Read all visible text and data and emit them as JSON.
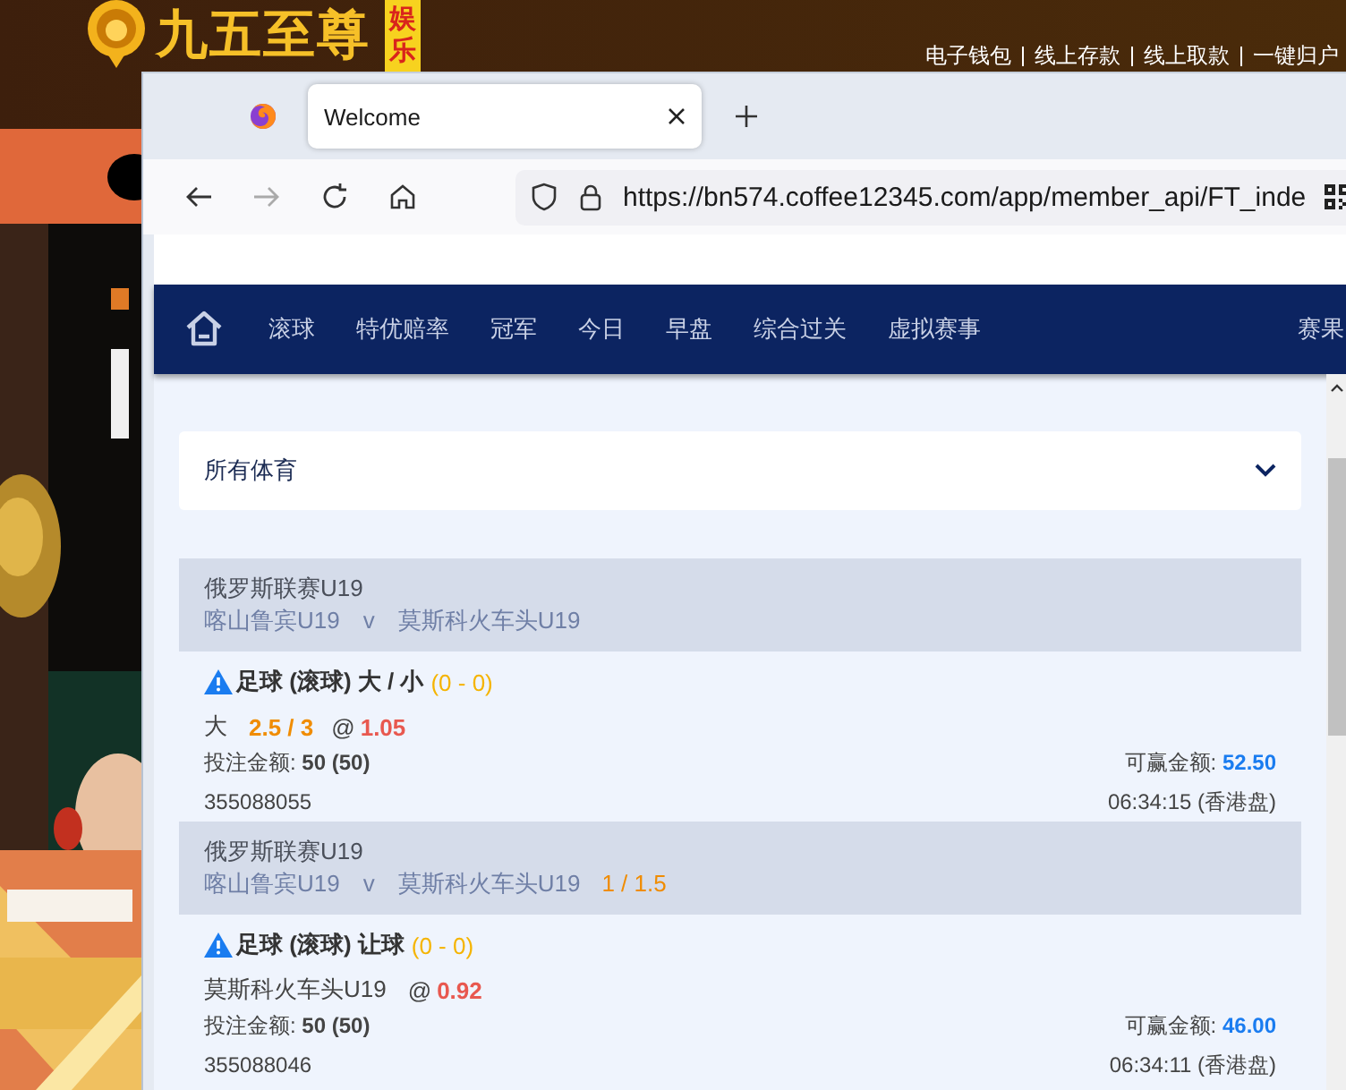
{
  "background_site": {
    "logo_text": "九五至尊",
    "logo_badge": "娱乐",
    "links": [
      "电子钱包",
      "线上存款",
      "线上取款",
      "一键归户"
    ]
  },
  "browser": {
    "tab": {
      "title": "Welcome"
    },
    "address": "https://bn574.coffee12345.com/app/member_api/FT_inde"
  },
  "nav": {
    "items": [
      {
        "label": "滚球"
      },
      {
        "label": "特优赔率"
      },
      {
        "label": "冠军"
      },
      {
        "label": "今日"
      },
      {
        "label": "早盘"
      },
      {
        "label": "综合过关"
      },
      {
        "label": "虚拟赛事"
      },
      {
        "label": "赛果",
        "kind": "end"
      }
    ]
  },
  "sport_select": {
    "value": "所有体育"
  },
  "bets": [
    {
      "league": "俄罗斯联赛U19",
      "home": "喀山鲁宾U19",
      "vs": "v",
      "away": "莫斯科火车头U19",
      "market": "足球 (滚球) 大 / 小",
      "score": "(0 - 0)",
      "selection": "大",
      "line": "2.5 / 3",
      "at": "@",
      "odds": "1.05",
      "stake_label": "投注金额:",
      "stake": "50 (50)",
      "win_label": "可赢金额:",
      "win": "52.50",
      "ticket": "355088055",
      "time": "06:34:15 (香港盘)"
    },
    {
      "league": "俄罗斯联赛U19",
      "home": "喀山鲁宾U19",
      "vs": "v",
      "away": "莫斯科火车头U19",
      "handicap": "1 / 1.5",
      "market": "足球 (滚球) 让球",
      "score": "(0 - 0)",
      "selection": "莫斯科火车头U19",
      "at": "@",
      "odds": "0.92",
      "stake_label": "投注金额:",
      "stake": "50 (50)",
      "win_label": "可赢金额:",
      "win": "46.00",
      "ticket": "355088046",
      "time": "06:34:11 (香港盘)"
    }
  ]
}
